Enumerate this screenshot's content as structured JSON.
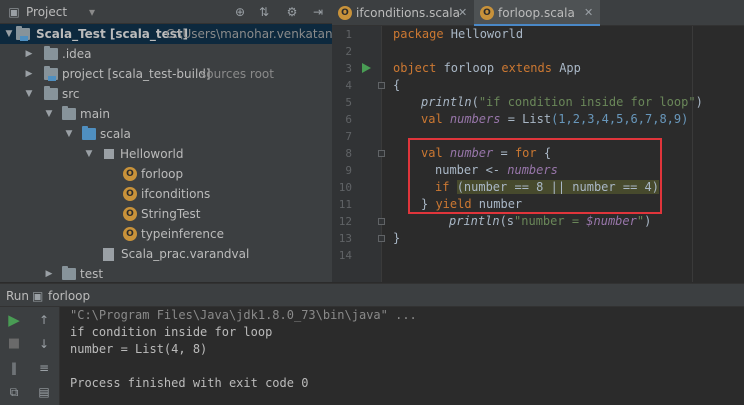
{
  "project_panel": {
    "title": "Project",
    "header_icons": [
      "globe-icon",
      "collapse-icon",
      "gear-icon",
      "hide-icon"
    ],
    "tree": [
      {
        "label": "Scala_Test [scala_test]",
        "extra": "C:\\Users\\manohar.venkatanaray",
        "icon": "module-folder-icon",
        "arrow": "▾",
        "selected": true
      },
      {
        "label": ".idea",
        "extra": "",
        "icon": "folder-icon",
        "arrow": "▸"
      },
      {
        "label": "project [scala_test-build]",
        "extra": "sources root",
        "icon": "source-folder-icon",
        "arrow": "▸"
      },
      {
        "label": "src",
        "extra": "",
        "icon": "folder-icon",
        "arrow": "▾"
      },
      {
        "label": "main",
        "extra": "",
        "icon": "folder-icon",
        "arrow": "▾"
      },
      {
        "label": "scala",
        "extra": "",
        "icon": "source-folder-icon",
        "arrow": "▾"
      },
      {
        "label": "Helloworld",
        "extra": "",
        "icon": "package-icon",
        "arrow": "▾"
      },
      {
        "label": "forloop",
        "extra": "",
        "icon": "scala-object-icon"
      },
      {
        "label": "ifconditions",
        "extra": "",
        "icon": "scala-object-icon"
      },
      {
        "label": "StringTest",
        "extra": "",
        "icon": "scala-object-icon"
      },
      {
        "label": "typeinference",
        "extra": "",
        "icon": "scala-object-icon"
      },
      {
        "label": "Scala_prac.varandval",
        "extra": "",
        "icon": "scala-file-icon"
      },
      {
        "label": "test",
        "extra": "",
        "icon": "folder-icon",
        "arrow": "▸"
      }
    ]
  },
  "editor": {
    "tabs": [
      {
        "label": "ifconditions.scala",
        "active": false
      },
      {
        "label": "forloop.scala",
        "active": true
      }
    ],
    "line_numbers": [
      "1",
      "2",
      "3",
      "4",
      "5",
      "6",
      "7",
      "8",
      "9",
      "10",
      "11",
      "12",
      "13",
      "14"
    ],
    "code": {
      "l1_kw": "package",
      "l1_rest": " Helloworld",
      "l3_kw1": "object",
      "l3_name": " forloop ",
      "l3_kw2": "extends",
      "l3_rest": " App",
      "l4": "{",
      "l5_fn": "println",
      "l5_open": "(",
      "l5_str": "\"if condition inside for loop\"",
      "l5_close": ")",
      "l6_kw": "val",
      "l6_var": " numbers",
      "l6_eq": " = ",
      "l6_fn": "List",
      "l6_args": "(1,2,3,4,5,6,7,8,9)",
      "l8_kw": "val",
      "l8_var": " number",
      "l8_eq": " = ",
      "l8_kw2": "for",
      "l8_brace": " {",
      "l9_a": "number <- ",
      "l9_b": "numbers",
      "l10_kw": "if",
      "l10_sp": " ",
      "l10_cond": "(number == 8 || number == 4)",
      "l11_brace": "} ",
      "l11_kw": "yield",
      "l11_rest": " number",
      "l12_fn": "println",
      "l12_open": "(s",
      "l12_str": "\"number = ",
      "l12_var": "$number",
      "l12_end": "\"",
      "l12_close": ")",
      "l13": "}"
    }
  },
  "run_panel": {
    "label": "Run",
    "config": "forloop",
    "output": [
      "\"C:\\Program Files\\Java\\jdk1.8.0_73\\bin\\java\" ...",
      "if condition inside for loop",
      "number = List(4, 8)",
      "",
      "Process finished with exit code 0"
    ]
  }
}
